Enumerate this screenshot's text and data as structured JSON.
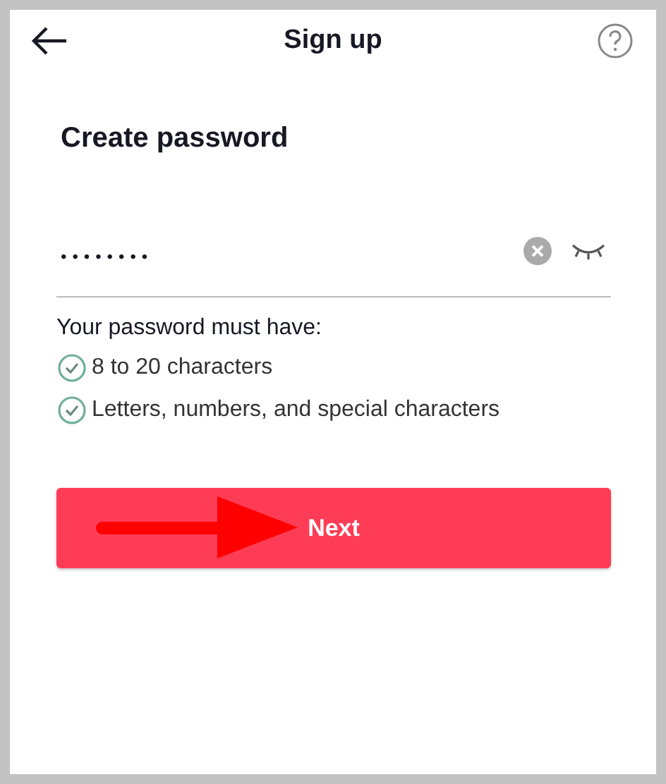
{
  "header": {
    "title": "Sign up"
  },
  "heading": "Create password",
  "password": {
    "value": "••••••••"
  },
  "requirements": {
    "title": "Your password must have:",
    "items": [
      {
        "text": "8 to 20 characters",
        "met": true
      },
      {
        "text": "Letters, numbers, and special characters",
        "met": true
      }
    ]
  },
  "next_button": {
    "label": "Next",
    "disabled": false
  }
}
